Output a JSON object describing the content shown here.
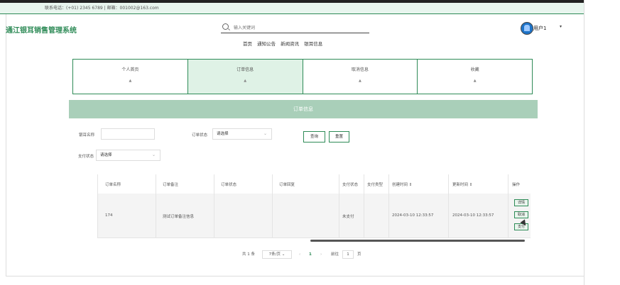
{
  "contact": "联系电话：(+01) 2345 6789 | 邮箱：001002@163.com",
  "app_title": "通江银耳销售管理系统",
  "search": {
    "placeholder": "输入关键词"
  },
  "nav": [
    "首页",
    "通知公告",
    "新闻资讯",
    "银耳信息"
  ],
  "user": {
    "name": "用户1",
    "caret": "▾"
  },
  "cards": [
    {
      "label": "个人首页",
      "icon": "▲"
    },
    {
      "label": "订单信息",
      "icon": "▲"
    },
    {
      "label": "取消信息",
      "icon": "▲"
    },
    {
      "label": "收藏",
      "icon": "▲"
    }
  ],
  "section_title": "订单信息",
  "filters": {
    "name_label": "银耳名称",
    "name_value": "",
    "status_label": "订单状态",
    "status_value": "请选择",
    "pay_label": "支付状态",
    "pay_value": "请选择",
    "query_btn": "查询",
    "reset_btn": "重置"
  },
  "table": {
    "headers": [
      "订单名称",
      "订单备注",
      "订单状态",
      "订单回复",
      "支付状态",
      "支付类型",
      "创建时间 ⇕",
      "更新时间 ⇕",
      "操作"
    ],
    "rows": [
      {
        "name": "174",
        "remark": "测试订单备注信息",
        "status": "",
        "reply": "",
        "pay_status": "未支付",
        "pay_type": "",
        "created": "2024-03-10 12:33:57",
        "updated": "2024-03-10 12:33:57",
        "actions": [
          "详情",
          "取消",
          "支付"
        ]
      }
    ]
  },
  "pager": {
    "total": "共 1 条",
    "page_size": "7条/页",
    "prev": "‹",
    "current": "1",
    "next": "›",
    "goto_label": "前往",
    "goto_value": "1",
    "page_unit": "页"
  }
}
